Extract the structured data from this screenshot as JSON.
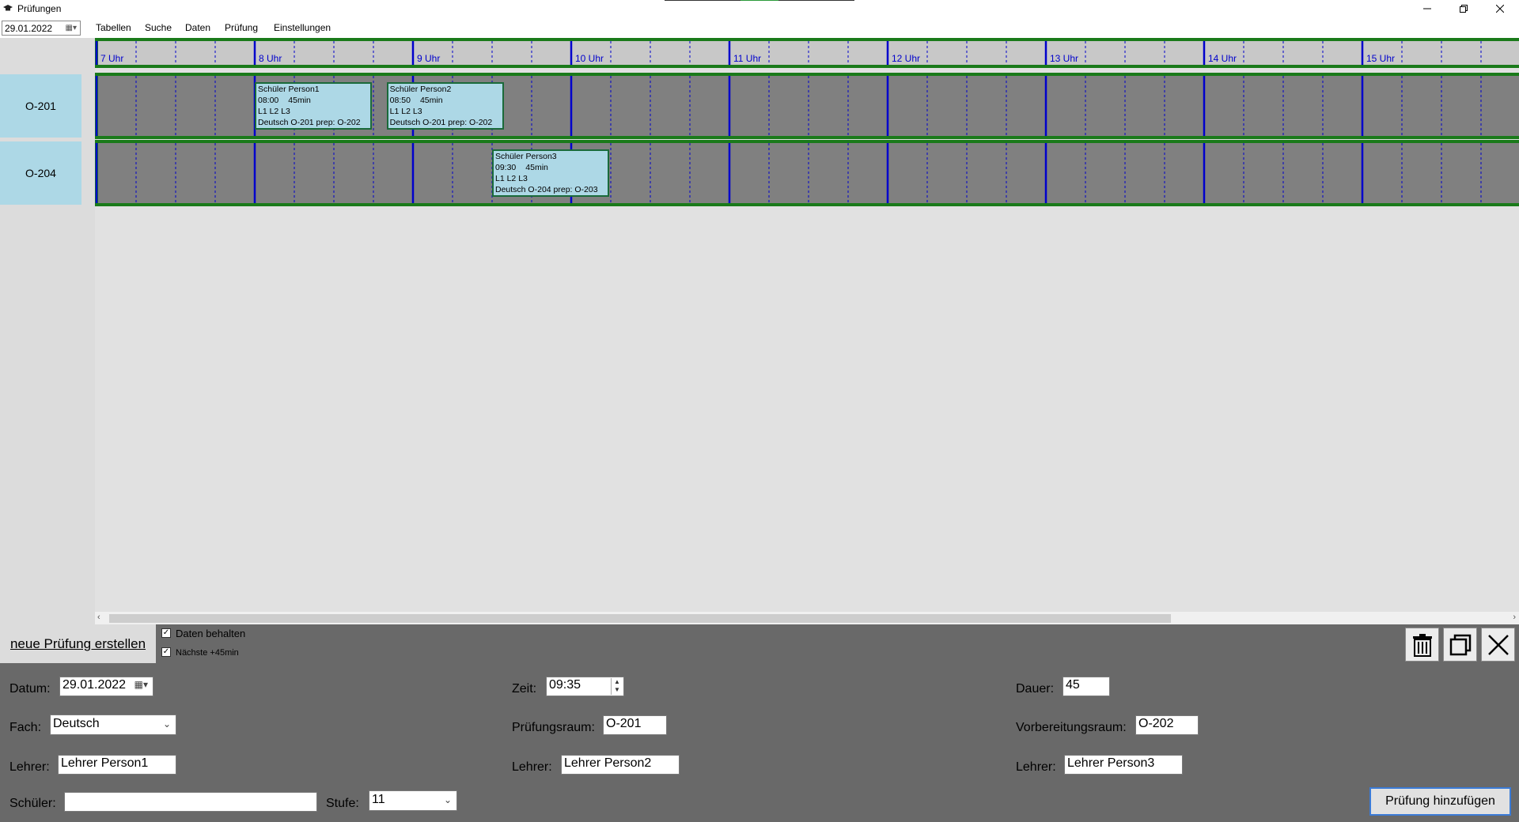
{
  "window": {
    "title": "Prüfungen",
    "controls": [
      "minimize",
      "restore",
      "close"
    ]
  },
  "menubar": {
    "date": "29.01.2022",
    "items": [
      "Tabellen",
      "Suche",
      "Daten",
      "Prüfung",
      "Einstellungen"
    ]
  },
  "timeline": {
    "hours": [
      "7 Uhr",
      "8 Uhr",
      "9 Uhr",
      "10 Uhr",
      "11 Uhr",
      "12 Uhr",
      "13 Uhr",
      "14 Uhr",
      "15 Uhr"
    ],
    "rooms": [
      "O-201",
      "O-204"
    ],
    "exams": [
      {
        "room": "O-201",
        "student": "Schüler Person1",
        "time": "08:00",
        "duration": "45min",
        "teachers": "L1  L2  L3",
        "details": "Deutsch O-201  prep: O-202"
      },
      {
        "room": "O-201",
        "student": "Schüler Person2",
        "time": "08:50",
        "duration": "45min",
        "teachers": "L1  L2  L3",
        "details": "Deutsch O-201  prep: O-202"
      },
      {
        "room": "O-204",
        "student": "Schüler Person3",
        "time": "09:30",
        "duration": "45min",
        "teachers": "L1  L2  L3",
        "details": "Deutsch O-204  prep: O-203"
      }
    ]
  },
  "colors": {
    "room_label": "#add8e6",
    "track": "#808080",
    "track_border": "#1a7a1a",
    "hour_line": "#0000cc",
    "exam_block": "#add8e6"
  },
  "form": {
    "new_exam_button": "neue Prüfung erstellen",
    "keep_data_label": "Daten behalten",
    "keep_data_checked": true,
    "next_label": "Nächste +45min",
    "next_checked": true,
    "icons": [
      "trash-icon",
      "copy-icon",
      "close-icon"
    ],
    "datum_label": "Datum:",
    "datum_value": "29.01.2022",
    "zeit_label": "Zeit:",
    "zeit_value": "09:35",
    "dauer_label": "Dauer:",
    "dauer_value": "45",
    "fach_label": "Fach:",
    "fach_value": "Deutsch",
    "pruefungsraum_label": "Prüfungsraum:",
    "pruefungsraum_value": "O-201",
    "vorbereitungsraum_label": "Vorbereitungsraum:",
    "vorbereitungsraum_value": "O-202",
    "lehrer_label": "Lehrer:",
    "lehrer1_value": "Lehrer Person1",
    "lehrer2_value": "Lehrer Person2",
    "lehrer3_value": "Lehrer Person3",
    "schueler_label": "Schüler:",
    "schueler_value": "",
    "stufe_label": "Stufe:",
    "stufe_value": "11",
    "add_button": "Prüfung hinzufügen"
  }
}
